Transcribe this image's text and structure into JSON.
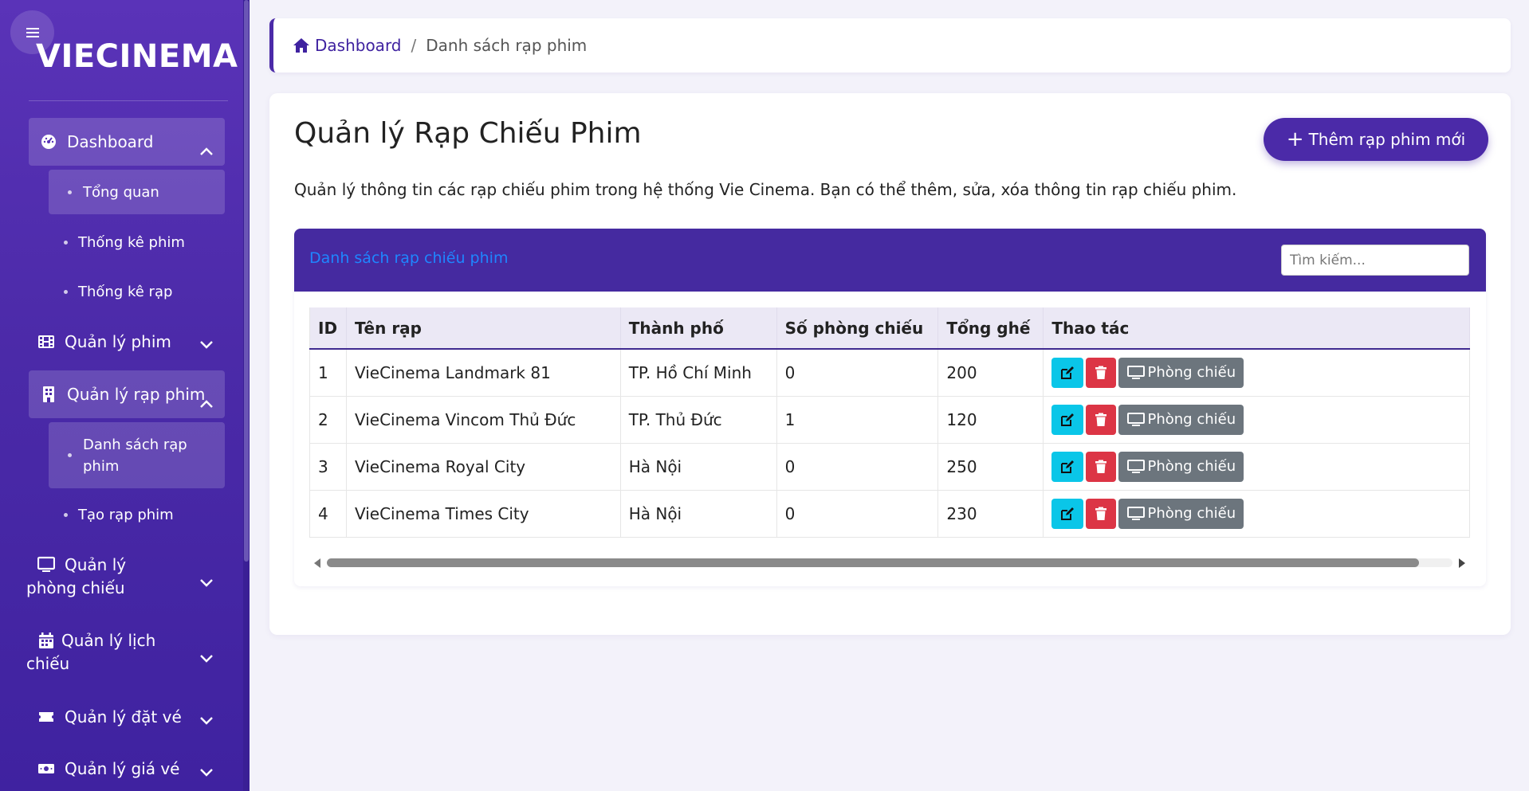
{
  "brand": "VIECINEMA",
  "sidebar": {
    "items": [
      {
        "label": "Dashboard",
        "icon": "gauge-icon",
        "expanded": true
      },
      {
        "label": "Quản lý phim",
        "icon": "film-icon",
        "expanded": false
      },
      {
        "label": "Quản lý rạp phim",
        "icon": "building-icon",
        "expanded": true
      },
      {
        "label": "Quản lý phòng chiếu",
        "icon": "monitor-icon",
        "expanded": false
      },
      {
        "label": "Quản lý lịch chiếu",
        "icon": "calendar-icon",
        "expanded": false
      },
      {
        "label": "Quản lý đặt vé",
        "icon": "ticket-icon",
        "expanded": false
      },
      {
        "label": "Quản lý giá vé",
        "icon": "money-icon",
        "expanded": false
      }
    ],
    "dashboard_sub": [
      "Tổng quan",
      "Thống kê phim",
      "Thống kê rạp"
    ],
    "rap_sub": [
      "Danh sách rạp phim",
      "Tạo rạp phim"
    ]
  },
  "breadcrumb": {
    "home": "Dashboard",
    "separator": "/",
    "current": "Danh sách rạp phim"
  },
  "page": {
    "title": "Quản lý Rạp Chiếu Phim",
    "add_button": "Thêm rạp phim mới",
    "description": "Quản lý thông tin các rạp chiếu phim trong hệ thống Vie Cinema. Bạn có thể thêm, sửa, xóa thông tin rạp chiếu phim."
  },
  "table_card": {
    "title": "Danh sách rạp chiếu phim",
    "search_placeholder": "Tìm kiếm..."
  },
  "table": {
    "columns": [
      "ID",
      "Tên rạp",
      "Thành phố",
      "Số phòng chiếu",
      "Tổng ghế",
      "Thao tác"
    ],
    "rows": [
      {
        "id": "1",
        "name": "VieCinema Landmark 81",
        "city": "TP. Hồ Chí Minh",
        "rooms": "0",
        "seats": "200"
      },
      {
        "id": "2",
        "name": "VieCinema Vincom Thủ Đức",
        "city": "TP. Thủ Đức",
        "rooms": "1",
        "seats": "120"
      },
      {
        "id": "3",
        "name": "VieCinema Royal City",
        "city": "Hà Nội",
        "rooms": "0",
        "seats": "250"
      },
      {
        "id": "4",
        "name": "VieCinema Times City",
        "city": "Hà Nội",
        "rooms": "0",
        "seats": "230"
      }
    ],
    "room_button": "Phòng chiếu"
  },
  "colors": {
    "sidebar": "#4b2aa8",
    "accent": "#4b2aa8",
    "table_header": "#452aa0",
    "edit": "#0ac6e8",
    "delete": "#dc3545",
    "room": "#6c757d",
    "link_blue": "#1f86ff"
  },
  "scroll": {
    "horizontal_fraction": 0.97
  }
}
